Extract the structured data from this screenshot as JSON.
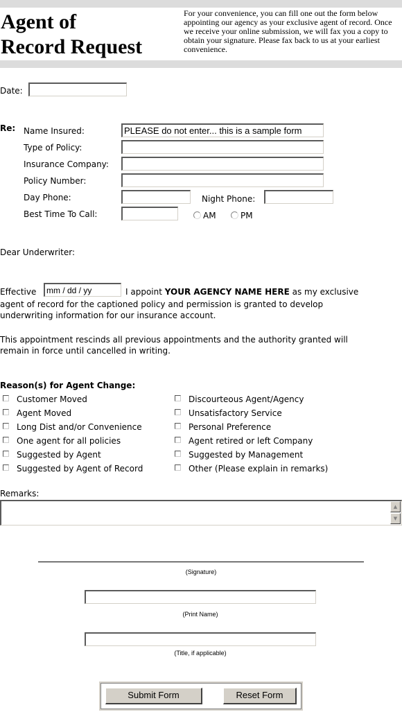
{
  "header": {
    "title_line1": "Agent of",
    "title_line2": "Record Request",
    "intro_text": "For your convenience, you can fill one out the form below appointing our agency as your exclusive agent of record. Once we receive your online submission, we will fax you a copy to obtain your signature. Please fax back to us at your earliest convenience."
  },
  "date": {
    "label": "Date:",
    "value": ""
  },
  "re": {
    "label": "Re:",
    "name_insured": {
      "label": "Name Insured:",
      "value": "PLEASE do not enter... this is a sample form"
    },
    "type_of_policy": {
      "label": "Type of Policy:",
      "value": ""
    },
    "insurance_company": {
      "label": "Insurance Company:",
      "value": ""
    },
    "policy_number": {
      "label": "Policy Number:",
      "value": ""
    },
    "day_phone": {
      "label": "Day Phone:",
      "value": ""
    },
    "night_phone": {
      "label": "Night Phone:",
      "value": ""
    },
    "best_time": {
      "label": "Best Time To Call:",
      "value": "",
      "am_label": "AM",
      "pm_label": "PM"
    }
  },
  "letter": {
    "salutation": "Dear Underwriter:",
    "effective_label": "Effective",
    "effective_value": "mm / dd / yy",
    "appoint_text": "I appoint",
    "agency_name": "YOUR AGENCY NAME HERE",
    "after_agency": "as my exclusive",
    "para1_line2": "agent of record for the captioned policy and permission is granted to develop",
    "para1_line3": "underwriting information for our insurance account.",
    "para2_line1": "This appointment rescinds all previous appointments and the authority granted will",
    "para2_line2": "remain in force until cancelled in writing."
  },
  "reasons": {
    "heading": "Reason(s) for Agent Change:",
    "left": [
      "Customer Moved",
      "Agent Moved",
      "Long Dist and/or Convenience",
      "One agent for all policies",
      "Suggested by Agent",
      "Suggested by Agent of Record"
    ],
    "right": [
      "Discourteous Agent/Agency",
      "Unsatisfactory Service",
      "Personal Preference",
      "Agent retired or left Company",
      "Suggested by Management",
      "Other (Please explain in remarks)"
    ]
  },
  "remarks": {
    "label": "Remarks:",
    "value": ""
  },
  "signature": {
    "signature_caption": "(Signature)",
    "print_name_caption": "(Print Name)",
    "print_name_value": "",
    "title_caption": "(Title, if applicable)",
    "title_value": ""
  },
  "buttons": {
    "submit": "Submit Form",
    "reset": "Reset Form"
  }
}
